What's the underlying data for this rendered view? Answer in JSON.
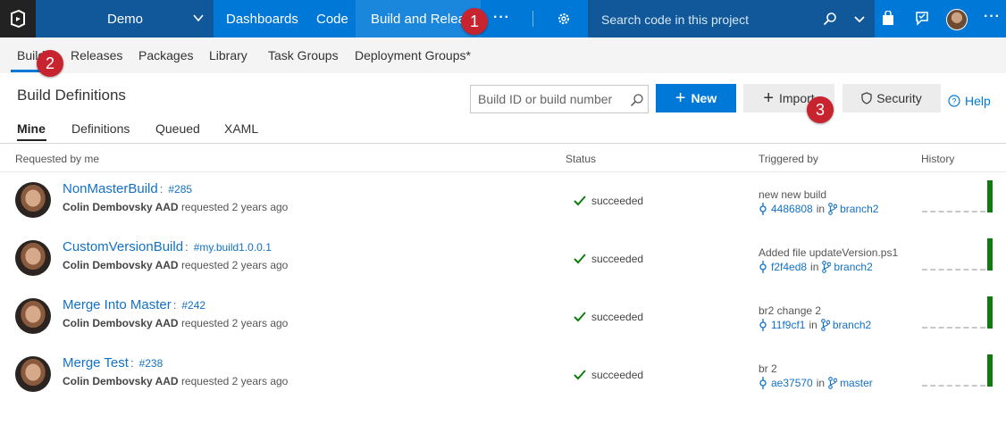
{
  "topbar": {
    "project": "Demo",
    "nav": [
      "Dashboards",
      "Code",
      "Build and Release"
    ],
    "more": "···",
    "search_placeholder": "Search code in this project"
  },
  "subnav": [
    "Builds",
    "Releases",
    "Packages",
    "Library",
    "Task Groups",
    "Deployment Groups*"
  ],
  "badges": [
    "1",
    "2",
    "3"
  ],
  "page_title": "Build Definitions",
  "build_search_placeholder": "Build ID or build number",
  "buttons": {
    "new": "New",
    "import": "Import",
    "security": "Security",
    "help": "Help"
  },
  "tabs": [
    "Mine",
    "Definitions",
    "Queued",
    "XAML"
  ],
  "columns": [
    "Requested by me",
    "Status",
    "Triggered by",
    "History"
  ],
  "requested_suffix": "requested 2 years ago",
  "in_word": "in",
  "builds": [
    {
      "name": "NonMasterBuild",
      "number": "#285",
      "requester": "Colin Dembovsky AAD",
      "status": "succeeded",
      "message": "new new build",
      "commit": "4486808",
      "branch": "branch2"
    },
    {
      "name": "CustomVersionBuild",
      "number": "#my.build1.0.0.1",
      "requester": "Colin Dembovsky AAD",
      "status": "succeeded",
      "message": "Added file updateVersion.ps1",
      "commit": "f2f4ed8",
      "branch": "branch2"
    },
    {
      "name": "Merge Into Master",
      "number": "#242",
      "requester": "Colin Dembovsky AAD",
      "status": "succeeded",
      "message": "br2 change 2",
      "commit": "11f9cf1",
      "branch": "branch2"
    },
    {
      "name": "Merge Test",
      "number": "#238",
      "requester": "Colin Dembovsky AAD",
      "status": "succeeded",
      "message": "br 2",
      "commit": "ae37570",
      "branch": "master"
    }
  ],
  "colors": {
    "brand": "#0078d7",
    "success": "#107c10",
    "badge": "#c8242f"
  }
}
